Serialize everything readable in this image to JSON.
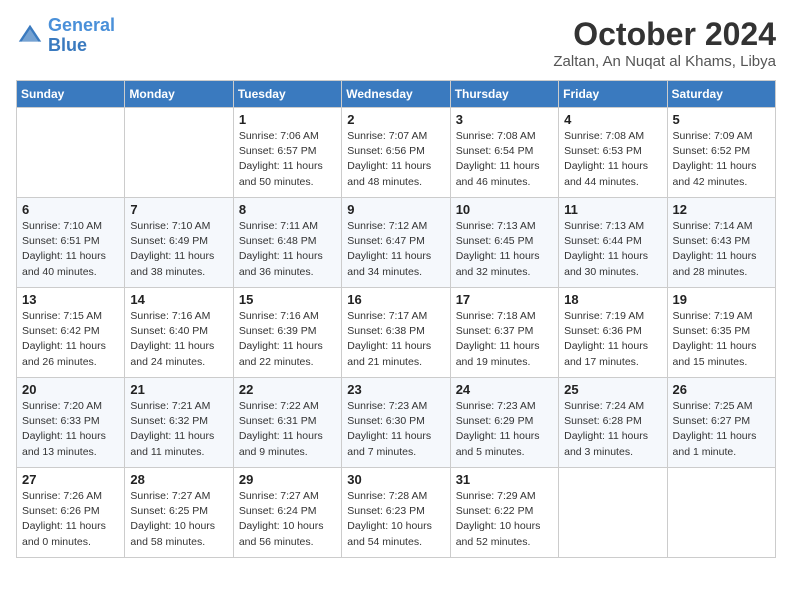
{
  "logo": {
    "line1": "General",
    "line2": "Blue"
  },
  "title": "October 2024",
  "location": "Zaltan, An Nuqat al Khams, Libya",
  "weekdays": [
    "Sunday",
    "Monday",
    "Tuesday",
    "Wednesday",
    "Thursday",
    "Friday",
    "Saturday"
  ],
  "weeks": [
    [
      {
        "day": "",
        "sunrise": "",
        "sunset": "",
        "daylight": ""
      },
      {
        "day": "",
        "sunrise": "",
        "sunset": "",
        "daylight": ""
      },
      {
        "day": "1",
        "sunrise": "Sunrise: 7:06 AM",
        "sunset": "Sunset: 6:57 PM",
        "daylight": "Daylight: 11 hours and 50 minutes."
      },
      {
        "day": "2",
        "sunrise": "Sunrise: 7:07 AM",
        "sunset": "Sunset: 6:56 PM",
        "daylight": "Daylight: 11 hours and 48 minutes."
      },
      {
        "day": "3",
        "sunrise": "Sunrise: 7:08 AM",
        "sunset": "Sunset: 6:54 PM",
        "daylight": "Daylight: 11 hours and 46 minutes."
      },
      {
        "day": "4",
        "sunrise": "Sunrise: 7:08 AM",
        "sunset": "Sunset: 6:53 PM",
        "daylight": "Daylight: 11 hours and 44 minutes."
      },
      {
        "day": "5",
        "sunrise": "Sunrise: 7:09 AM",
        "sunset": "Sunset: 6:52 PM",
        "daylight": "Daylight: 11 hours and 42 minutes."
      }
    ],
    [
      {
        "day": "6",
        "sunrise": "Sunrise: 7:10 AM",
        "sunset": "Sunset: 6:51 PM",
        "daylight": "Daylight: 11 hours and 40 minutes."
      },
      {
        "day": "7",
        "sunrise": "Sunrise: 7:10 AM",
        "sunset": "Sunset: 6:49 PM",
        "daylight": "Daylight: 11 hours and 38 minutes."
      },
      {
        "day": "8",
        "sunrise": "Sunrise: 7:11 AM",
        "sunset": "Sunset: 6:48 PM",
        "daylight": "Daylight: 11 hours and 36 minutes."
      },
      {
        "day": "9",
        "sunrise": "Sunrise: 7:12 AM",
        "sunset": "Sunset: 6:47 PM",
        "daylight": "Daylight: 11 hours and 34 minutes."
      },
      {
        "day": "10",
        "sunrise": "Sunrise: 7:13 AM",
        "sunset": "Sunset: 6:45 PM",
        "daylight": "Daylight: 11 hours and 32 minutes."
      },
      {
        "day": "11",
        "sunrise": "Sunrise: 7:13 AM",
        "sunset": "Sunset: 6:44 PM",
        "daylight": "Daylight: 11 hours and 30 minutes."
      },
      {
        "day": "12",
        "sunrise": "Sunrise: 7:14 AM",
        "sunset": "Sunset: 6:43 PM",
        "daylight": "Daylight: 11 hours and 28 minutes."
      }
    ],
    [
      {
        "day": "13",
        "sunrise": "Sunrise: 7:15 AM",
        "sunset": "Sunset: 6:42 PM",
        "daylight": "Daylight: 11 hours and 26 minutes."
      },
      {
        "day": "14",
        "sunrise": "Sunrise: 7:16 AM",
        "sunset": "Sunset: 6:40 PM",
        "daylight": "Daylight: 11 hours and 24 minutes."
      },
      {
        "day": "15",
        "sunrise": "Sunrise: 7:16 AM",
        "sunset": "Sunset: 6:39 PM",
        "daylight": "Daylight: 11 hours and 22 minutes."
      },
      {
        "day": "16",
        "sunrise": "Sunrise: 7:17 AM",
        "sunset": "Sunset: 6:38 PM",
        "daylight": "Daylight: 11 hours and 21 minutes."
      },
      {
        "day": "17",
        "sunrise": "Sunrise: 7:18 AM",
        "sunset": "Sunset: 6:37 PM",
        "daylight": "Daylight: 11 hours and 19 minutes."
      },
      {
        "day": "18",
        "sunrise": "Sunrise: 7:19 AM",
        "sunset": "Sunset: 6:36 PM",
        "daylight": "Daylight: 11 hours and 17 minutes."
      },
      {
        "day": "19",
        "sunrise": "Sunrise: 7:19 AM",
        "sunset": "Sunset: 6:35 PM",
        "daylight": "Daylight: 11 hours and 15 minutes."
      }
    ],
    [
      {
        "day": "20",
        "sunrise": "Sunrise: 7:20 AM",
        "sunset": "Sunset: 6:33 PM",
        "daylight": "Daylight: 11 hours and 13 minutes."
      },
      {
        "day": "21",
        "sunrise": "Sunrise: 7:21 AM",
        "sunset": "Sunset: 6:32 PM",
        "daylight": "Daylight: 11 hours and 11 minutes."
      },
      {
        "day": "22",
        "sunrise": "Sunrise: 7:22 AM",
        "sunset": "Sunset: 6:31 PM",
        "daylight": "Daylight: 11 hours and 9 minutes."
      },
      {
        "day": "23",
        "sunrise": "Sunrise: 7:23 AM",
        "sunset": "Sunset: 6:30 PM",
        "daylight": "Daylight: 11 hours and 7 minutes."
      },
      {
        "day": "24",
        "sunrise": "Sunrise: 7:23 AM",
        "sunset": "Sunset: 6:29 PM",
        "daylight": "Daylight: 11 hours and 5 minutes."
      },
      {
        "day": "25",
        "sunrise": "Sunrise: 7:24 AM",
        "sunset": "Sunset: 6:28 PM",
        "daylight": "Daylight: 11 hours and 3 minutes."
      },
      {
        "day": "26",
        "sunrise": "Sunrise: 7:25 AM",
        "sunset": "Sunset: 6:27 PM",
        "daylight": "Daylight: 11 hours and 1 minute."
      }
    ],
    [
      {
        "day": "27",
        "sunrise": "Sunrise: 7:26 AM",
        "sunset": "Sunset: 6:26 PM",
        "daylight": "Daylight: 11 hours and 0 minutes."
      },
      {
        "day": "28",
        "sunrise": "Sunrise: 7:27 AM",
        "sunset": "Sunset: 6:25 PM",
        "daylight": "Daylight: 10 hours and 58 minutes."
      },
      {
        "day": "29",
        "sunrise": "Sunrise: 7:27 AM",
        "sunset": "Sunset: 6:24 PM",
        "daylight": "Daylight: 10 hours and 56 minutes."
      },
      {
        "day": "30",
        "sunrise": "Sunrise: 7:28 AM",
        "sunset": "Sunset: 6:23 PM",
        "daylight": "Daylight: 10 hours and 54 minutes."
      },
      {
        "day": "31",
        "sunrise": "Sunrise: 7:29 AM",
        "sunset": "Sunset: 6:22 PM",
        "daylight": "Daylight: 10 hours and 52 minutes."
      },
      {
        "day": "",
        "sunrise": "",
        "sunset": "",
        "daylight": ""
      },
      {
        "day": "",
        "sunrise": "",
        "sunset": "",
        "daylight": ""
      }
    ]
  ]
}
